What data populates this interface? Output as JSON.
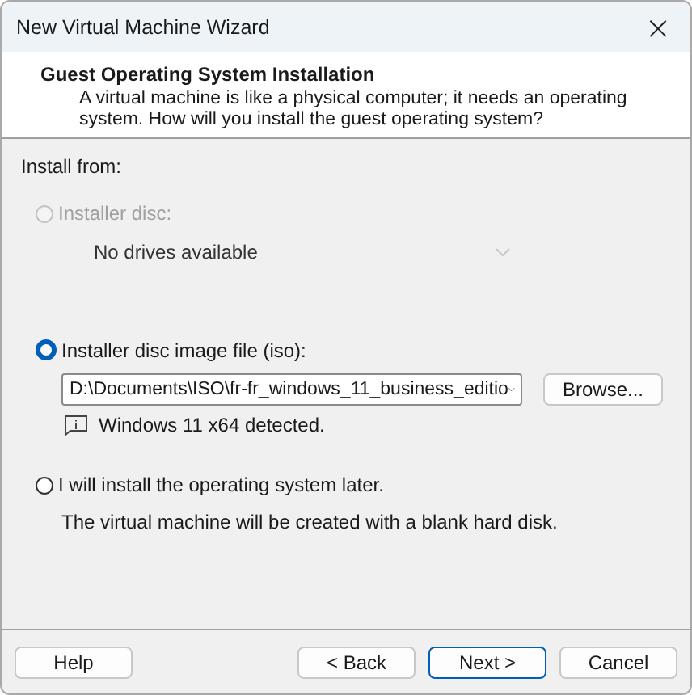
{
  "window": {
    "title": "New Virtual Machine Wizard",
    "close": "×"
  },
  "header": {
    "title": "Guest Operating System Installation",
    "description": "A virtual machine is like a physical computer; it needs an operating system. How will you install the guest operating system?"
  },
  "install_from": {
    "label": "Install from:",
    "options": [
      {
        "kind": "disc",
        "label": "Installer disc:",
        "selected": false,
        "disabled": true,
        "dropdown": {
          "value": "No drives available",
          "disabled": true
        }
      },
      {
        "kind": "iso",
        "label": "Installer disc image file (iso):",
        "selected": true,
        "disabled": false,
        "combo": {
          "value": "D:\\Documents\\ISO\\fr-fr_windows_11_business_editio"
        },
        "browse": "Browse...",
        "info": "Windows 11 x64 detected."
      },
      {
        "kind": "later",
        "label": "I will install the operating system later.",
        "selected": false,
        "disabled": false,
        "note": "The virtual machine will be created with a blank hard disk."
      }
    ]
  },
  "buttons": {
    "help": "Help",
    "back": "< Back",
    "next": "Next >",
    "cancel": "Cancel"
  }
}
